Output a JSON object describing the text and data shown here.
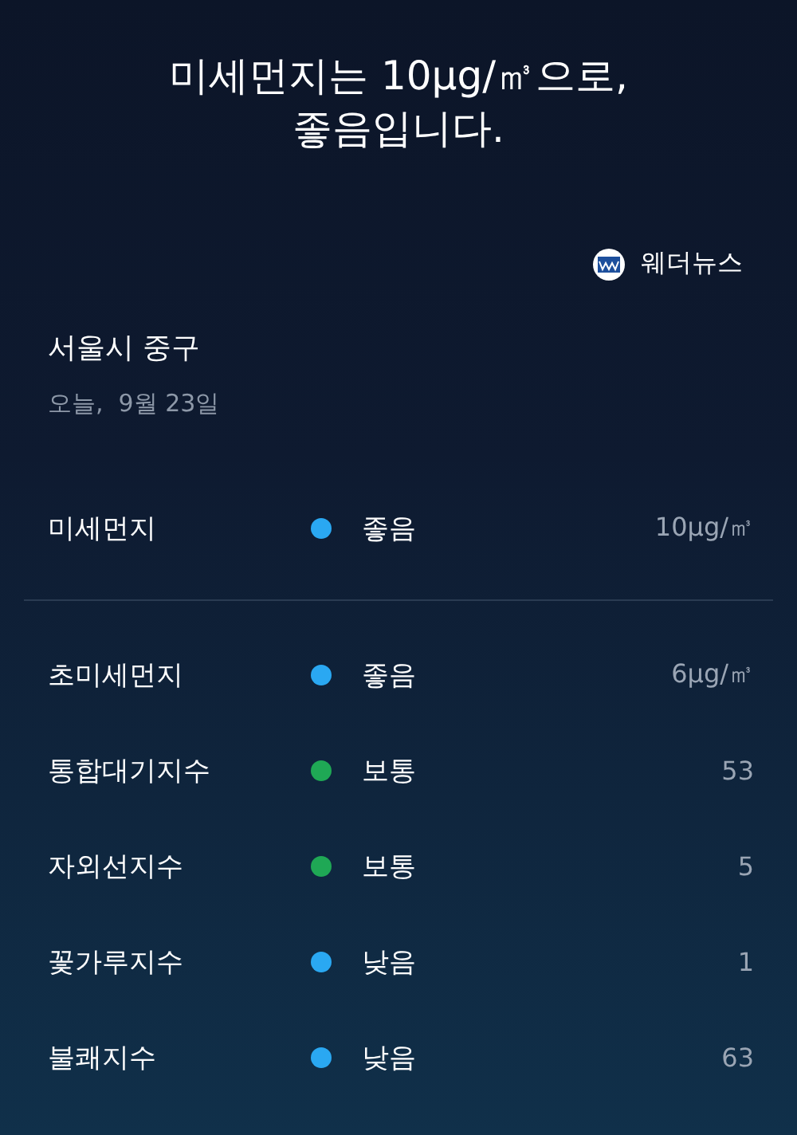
{
  "headline": [
    "미세먼지는 10μg/㎥으로,",
    "좋음입니다."
  ],
  "source": {
    "name": "웨더뉴스"
  },
  "location": {
    "name": "서울시 중구",
    "date": "오늘,  9월 23일"
  },
  "primary": {
    "name": "미세먼지",
    "color": "#2aa8f2",
    "status": "좋음",
    "value": "10μg/㎥"
  },
  "indices": [
    {
      "name": "초미세먼지",
      "color": "#2aa8f2",
      "status": "좋음",
      "value": "6μg/㎥"
    },
    {
      "name": "통합대기지수",
      "color": "#1fa855",
      "status": "보통",
      "value": "53"
    },
    {
      "name": "자외선지수",
      "color": "#1fa855",
      "status": "보통",
      "value": "5"
    },
    {
      "name": "꽃가루지수",
      "color": "#2aa8f2",
      "status": "낮음",
      "value": "1"
    },
    {
      "name": "불쾌지수",
      "color": "#2aa8f2",
      "status": "낮음",
      "value": "63"
    }
  ]
}
